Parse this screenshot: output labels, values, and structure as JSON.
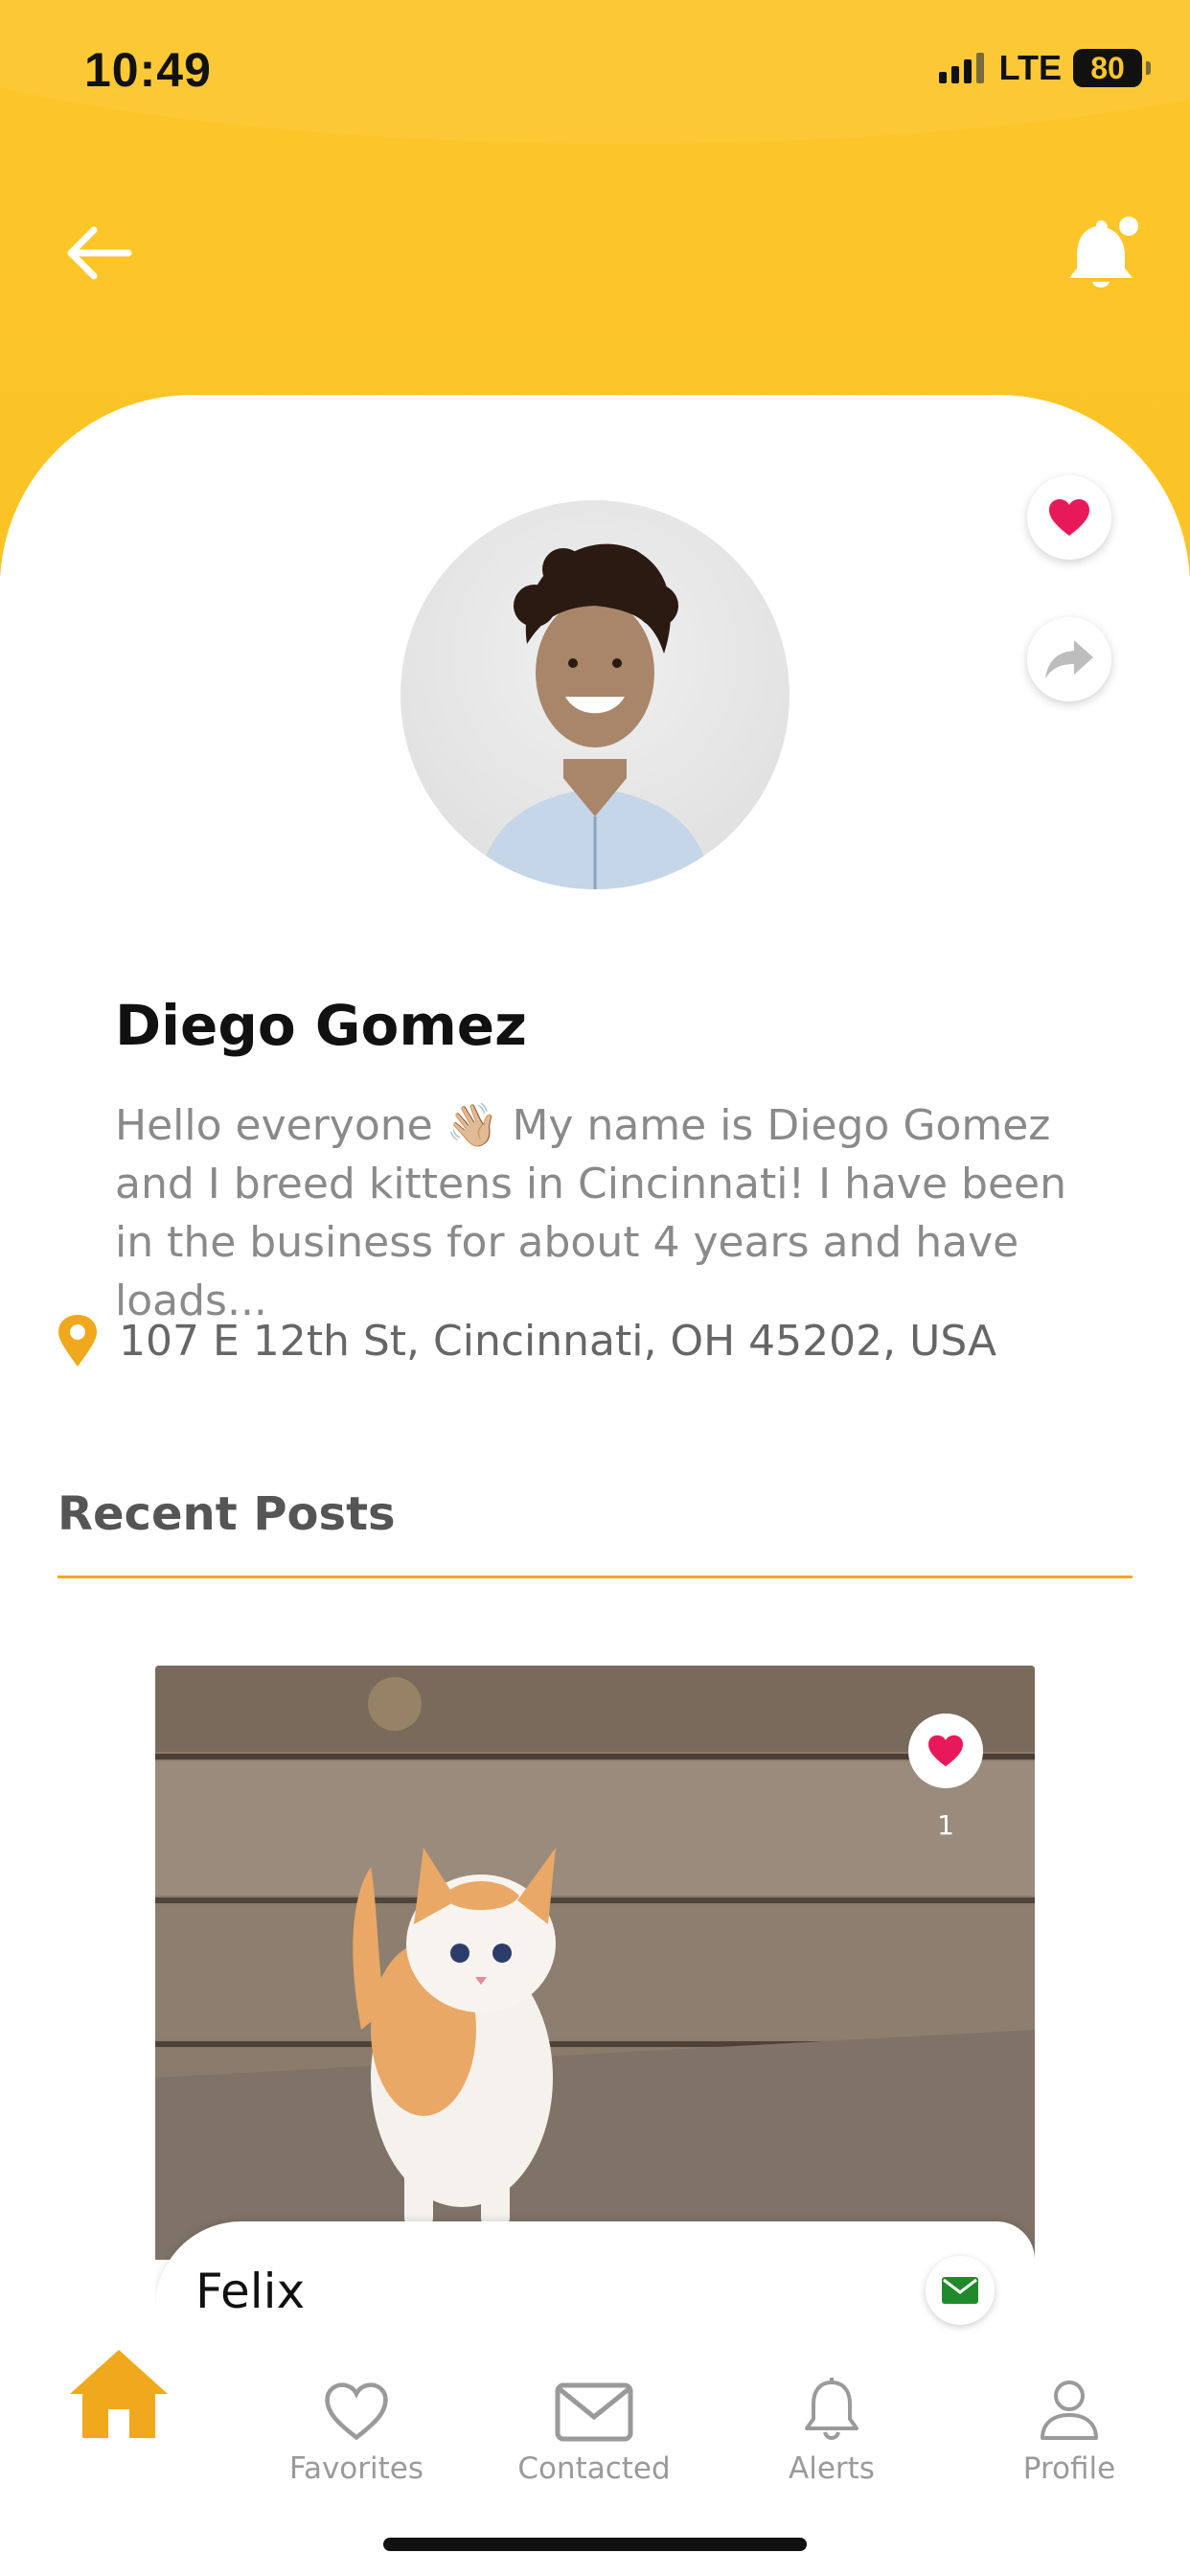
{
  "colors": {
    "header_yellow": "#fcc62a",
    "accent_orange": "#f0a81c",
    "like_red": "#e8195a",
    "message_green": "#1f8a2b",
    "tab_inactive": "#9a9a9a"
  },
  "status_bar": {
    "time": "10:49",
    "network": "LTE",
    "battery": "80"
  },
  "header": {
    "back_icon": "arrow-left-icon",
    "notification_icon": "bell-icon"
  },
  "profile": {
    "name": "Diego Gomez",
    "bio": "Hello everyone 👋🏼 My name is Diego Gomez and I breed kittens in Cincinnati! I have been in the business for about 4 years and have loads...",
    "address": "107 E 12th St, Cincinnati, OH 45202, USA",
    "favorite_icon": "heart-icon",
    "share_icon": "share-icon"
  },
  "recent_posts": {
    "title": "Recent Posts",
    "items": [
      {
        "name": "Felix",
        "likes": "1"
      }
    ]
  },
  "tab_bar": {
    "items": [
      {
        "label": "",
        "icon": "home-icon",
        "active": true
      },
      {
        "label": "Favorites",
        "icon": "heart-outline-icon",
        "active": false
      },
      {
        "label": "Contacted",
        "icon": "envelope-icon",
        "active": false
      },
      {
        "label": "Alerts",
        "icon": "bell-outline-icon",
        "active": false
      },
      {
        "label": "Profile",
        "icon": "user-icon",
        "active": false
      }
    ]
  }
}
